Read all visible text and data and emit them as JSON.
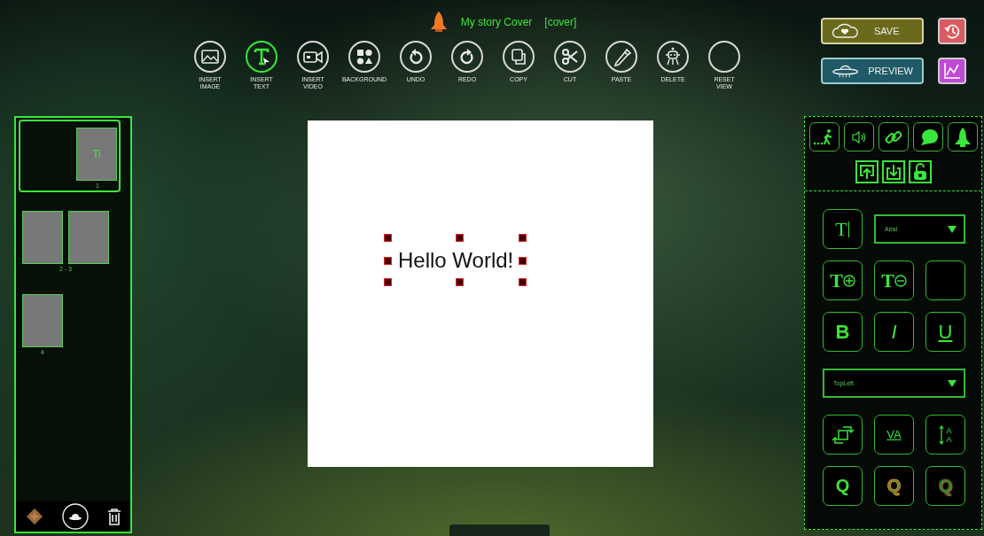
{
  "header": {
    "title": "My story Cover",
    "tag": "[cover]"
  },
  "toolbar": [
    {
      "kind": "image",
      "label": "INSERT IMAGE",
      "selected": false
    },
    {
      "kind": "text",
      "label": "INSERT TEXT",
      "selected": true
    },
    {
      "kind": "video",
      "label": "INSERT VIDEO",
      "selected": false
    },
    {
      "kind": "background",
      "label": "BACKGROUND",
      "selected": false
    },
    {
      "kind": "undo",
      "label": "UNDO",
      "selected": false
    },
    {
      "kind": "redo",
      "label": "REDO",
      "selected": false
    },
    {
      "kind": "copy",
      "label": "COPY",
      "selected": false
    },
    {
      "kind": "cut",
      "label": "CUT",
      "selected": false
    },
    {
      "kind": "paste",
      "label": "PASTE",
      "selected": false
    },
    {
      "kind": "delete",
      "label": "DELETE",
      "selected": false
    },
    {
      "kind": "reset",
      "label": "RESET VIEW",
      "selected": false
    }
  ],
  "actions": {
    "save": "SAVE",
    "preview": "PREVIEW"
  },
  "pages": [
    {
      "kind": "single",
      "label": "1",
      "selected": true,
      "thumb_text": "Ti"
    },
    {
      "kind": "spread",
      "label": "2 - 3",
      "selected": false
    },
    {
      "kind": "single",
      "label": "4",
      "selected": false
    }
  ],
  "canvas": {
    "text": "Hello World!",
    "selected": true
  },
  "panel": {
    "font": "Arial",
    "anchor": "TopLeft",
    "color": "#000000",
    "size_up": "T",
    "size_down": "T",
    "font_glyph": "T",
    "bold": "B",
    "italic": "I",
    "underline": "U",
    "spacing": "VA",
    "line_height": [
      "A",
      "A"
    ],
    "effects": [
      {
        "kind": "plain",
        "label": "Q"
      },
      {
        "kind": "outline",
        "label": "Q"
      },
      {
        "kind": "glow",
        "label": "Q"
      }
    ]
  }
}
